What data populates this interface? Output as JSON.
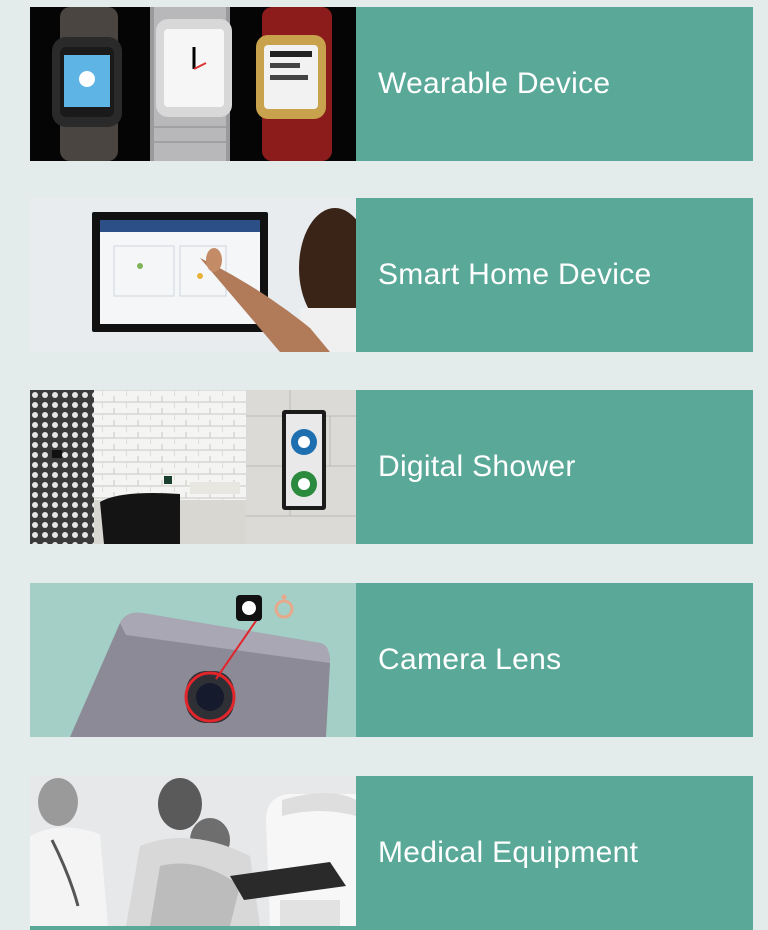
{
  "colors": {
    "background": "#e3ecea",
    "card": "#59a898",
    "text": "#ffffff"
  },
  "cards": [
    {
      "label": "Wearable Device",
      "image": "smartwatches-photo"
    },
    {
      "label": "Smart Home Device",
      "image": "wall-touchscreen-photo"
    },
    {
      "label": "Digital Shower",
      "image": "bathroom-shower-panel-photo"
    },
    {
      "label": "Camera Lens",
      "image": "phone-camera-lens-photo"
    },
    {
      "label": "Medical Equipment",
      "image": "medical-device-photo"
    }
  ]
}
